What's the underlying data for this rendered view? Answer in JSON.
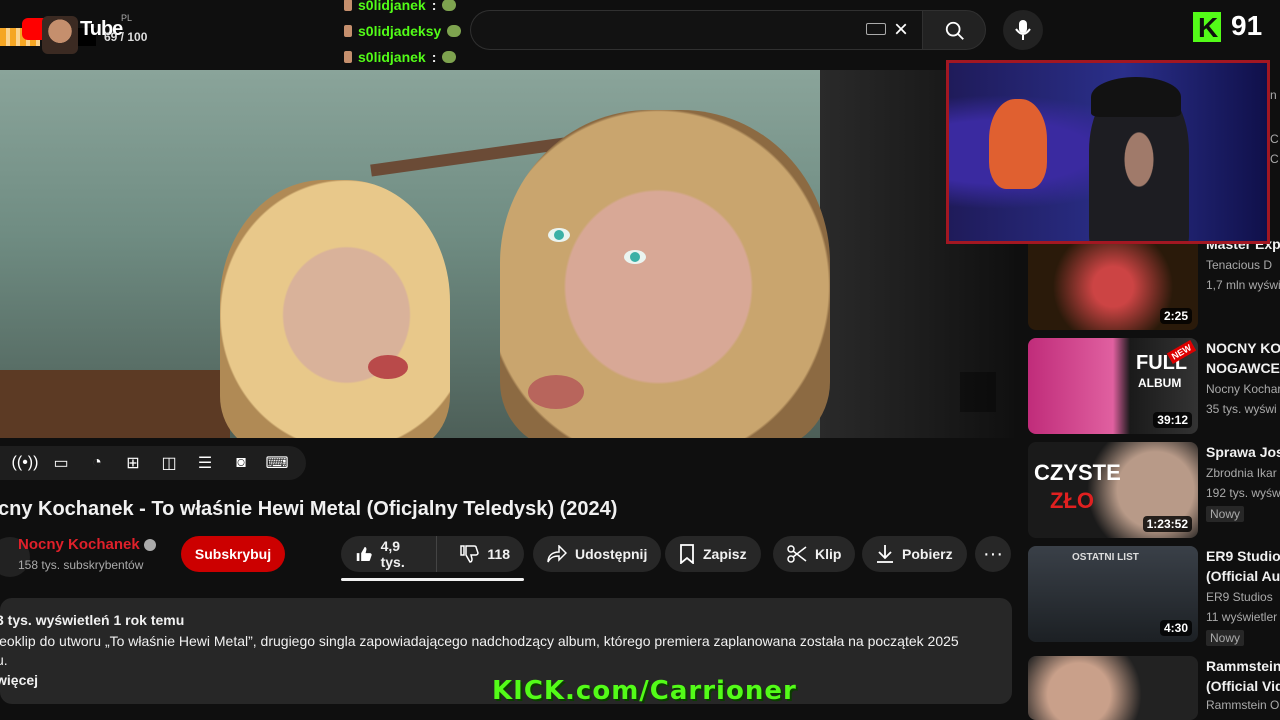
{
  "topbar": {
    "logo_text": "Tube",
    "country_code": "PL",
    "level_text": "69 / 100",
    "search_clear_icon": "close-icon",
    "search_icon": "search-icon",
    "mic_icon": "microphone-icon"
  },
  "chat": {
    "messages": [
      {
        "user": "s0lidjanek",
        "text": ":"
      },
      {
        "user": "s0lidjadeksy",
        "text": ""
      },
      {
        "user": "s0lidjanek",
        "text": ":"
      }
    ]
  },
  "kick": {
    "viewer_count": "91",
    "url_overlay": "KICK.com/Carrioner"
  },
  "video": {
    "title": "cny Kochanek - To właśnie Hewi Metal (Oficjalny Teledysk) (2024)"
  },
  "channel": {
    "name": "Nocny Kochanek",
    "subscribers": "158 tys. subskrybentów",
    "subscribe_label": "Subskrybuj"
  },
  "actions": {
    "likes": "4,9 tys.",
    "dislikes": "118",
    "share": "Udostępnij",
    "save": "Zapisz",
    "clip": "Klip",
    "download": "Pobierz",
    "more": "···"
  },
  "description": {
    "meta": "3 tys. wyświetleń  1 rok temu",
    "text": "leoklip do utworu „To właśnie Hewi Metal”, drugiego singla zapowiadającego nadchodzący album, którego premiera zaplanowana została na początek 2025",
    "text2": "u.",
    "more_label": "więcej"
  },
  "recommendations": [
    {
      "title": "Master Expl",
      "channel": "Tenacious D",
      "views": "1,7 mln wyświ",
      "duration": "2:25",
      "new_badge": ""
    },
    {
      "title": "NOCNY KOC",
      "title2": "NOGAWCE (",
      "channel": "Nocny Kochar",
      "views": "35 tys. wyświ",
      "duration": "39:12",
      "new_badge": ""
    },
    {
      "title": "Sprawa Jos",
      "channel": "Zbrodnia Ikar",
      "views": "192 tys. wyśw",
      "duration": "1:23:52",
      "new_badge": "Nowy"
    },
    {
      "title": "ER9 Studios",
      "title2": "(Official Aud",
      "channel": "ER9 Studios",
      "views": "11 wyświetler",
      "duration": "4:30",
      "new_badge": "Nowy"
    },
    {
      "title": "Rammstein",
      "title2": "(Official Vid",
      "channel": "Rammstein O",
      "views": "",
      "duration": "",
      "new_badge": ""
    }
  ],
  "thumb_texts": {
    "full_album": "FULL",
    "album": "ALBUM",
    "new_ribbon": "NEW",
    "czyste": "CZYSTE",
    "zlo": "ZŁO",
    "ostatni_list": "OSTATNI LIST"
  },
  "right_edge": [
    "n",
    "C",
    "C",
    "n"
  ],
  "colors": {
    "accent_red": "#cc0000",
    "kick_green": "#53fc18",
    "background": "#0f0f0f"
  }
}
